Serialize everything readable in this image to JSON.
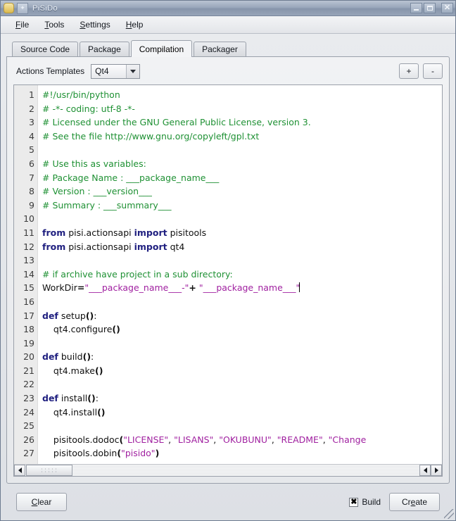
{
  "window": {
    "title": "PiSiDo",
    "app_icon": "package-icon",
    "menu_icon": "window-menu-icon",
    "controls": {
      "minimize": "minimize-icon",
      "maximize": "maximize-icon",
      "close": "close-icon"
    }
  },
  "menubar": {
    "items": [
      {
        "label": "File",
        "mnemonic": "F",
        "rest": "ile"
      },
      {
        "label": "Tools",
        "mnemonic": "T",
        "rest": "ools"
      },
      {
        "label": "Settings",
        "mnemonic": "S",
        "rest": "ettings"
      },
      {
        "label": "Help",
        "mnemonic": "H",
        "rest": "elp"
      }
    ]
  },
  "tabs": [
    {
      "label": "Source Code",
      "active": false
    },
    {
      "label": "Package",
      "active": false
    },
    {
      "label": "Compilation",
      "active": true
    },
    {
      "label": "Packager",
      "active": false
    }
  ],
  "templates": {
    "label": "Actions Templates",
    "combo_value": "Qt4",
    "combo_arrow_icon": "chevron-down-icon",
    "add_button": "+",
    "remove_button": "-"
  },
  "editor": {
    "first_line": 1,
    "total_lines": 27,
    "caret_line": 15,
    "lines": [
      "#!/usr/bin/python",
      "# -*- coding: utf-8 -*-",
      "# Licensed under the GNU General Public License, version 3.",
      "# See the file http://www.gnu.org/copyleft/gpl.txt",
      "",
      "# Use this as variables:",
      "# Package Name : ___package_name___",
      "# Version : ___version___",
      "# Summary : ___summary___",
      "",
      "from pisi.actionsapi import pisitools",
      "from pisi.actionsapi import qt4",
      "",
      "# if archive have project in a sub directory:",
      "WorkDir=\"___package_name___-\"+ \"___package_name___\"",
      "",
      "def setup():",
      "    qt4.configure()",
      "",
      "def build():",
      "    qt4.make()",
      "",
      "def install():",
      "    qt4.install()",
      "",
      "    pisitools.dodoc(\"LICENSE\", \"LISANS\", \"OKUBUNU\", \"README\", \"Change",
      "    pisitools.dobin(\"pisido\")"
    ]
  },
  "scrollbar": {
    "left_arrow_icon": "arrow-left-icon",
    "right_arrow_icon": "arrow-right-icon",
    "thumb_grip_icon": "grip-dots-icon"
  },
  "bottom": {
    "clear_button": {
      "pre": "",
      "mnemonic": "C",
      "rest": "lear"
    },
    "build_checkbox": {
      "label": "Build",
      "checked": true,
      "mark": "✖"
    },
    "create_button": {
      "pre": "Cr",
      "mnemonic": "e",
      "rest": "ate"
    }
  },
  "colors": {
    "comment": "#1f9134",
    "keyword": "#202080",
    "function": "#0b7a8c",
    "string": "#a020a0",
    "editor_bg": "#ffffff",
    "gutter_bg": "#ebebeb",
    "titlebar": "#8e9bb0"
  }
}
